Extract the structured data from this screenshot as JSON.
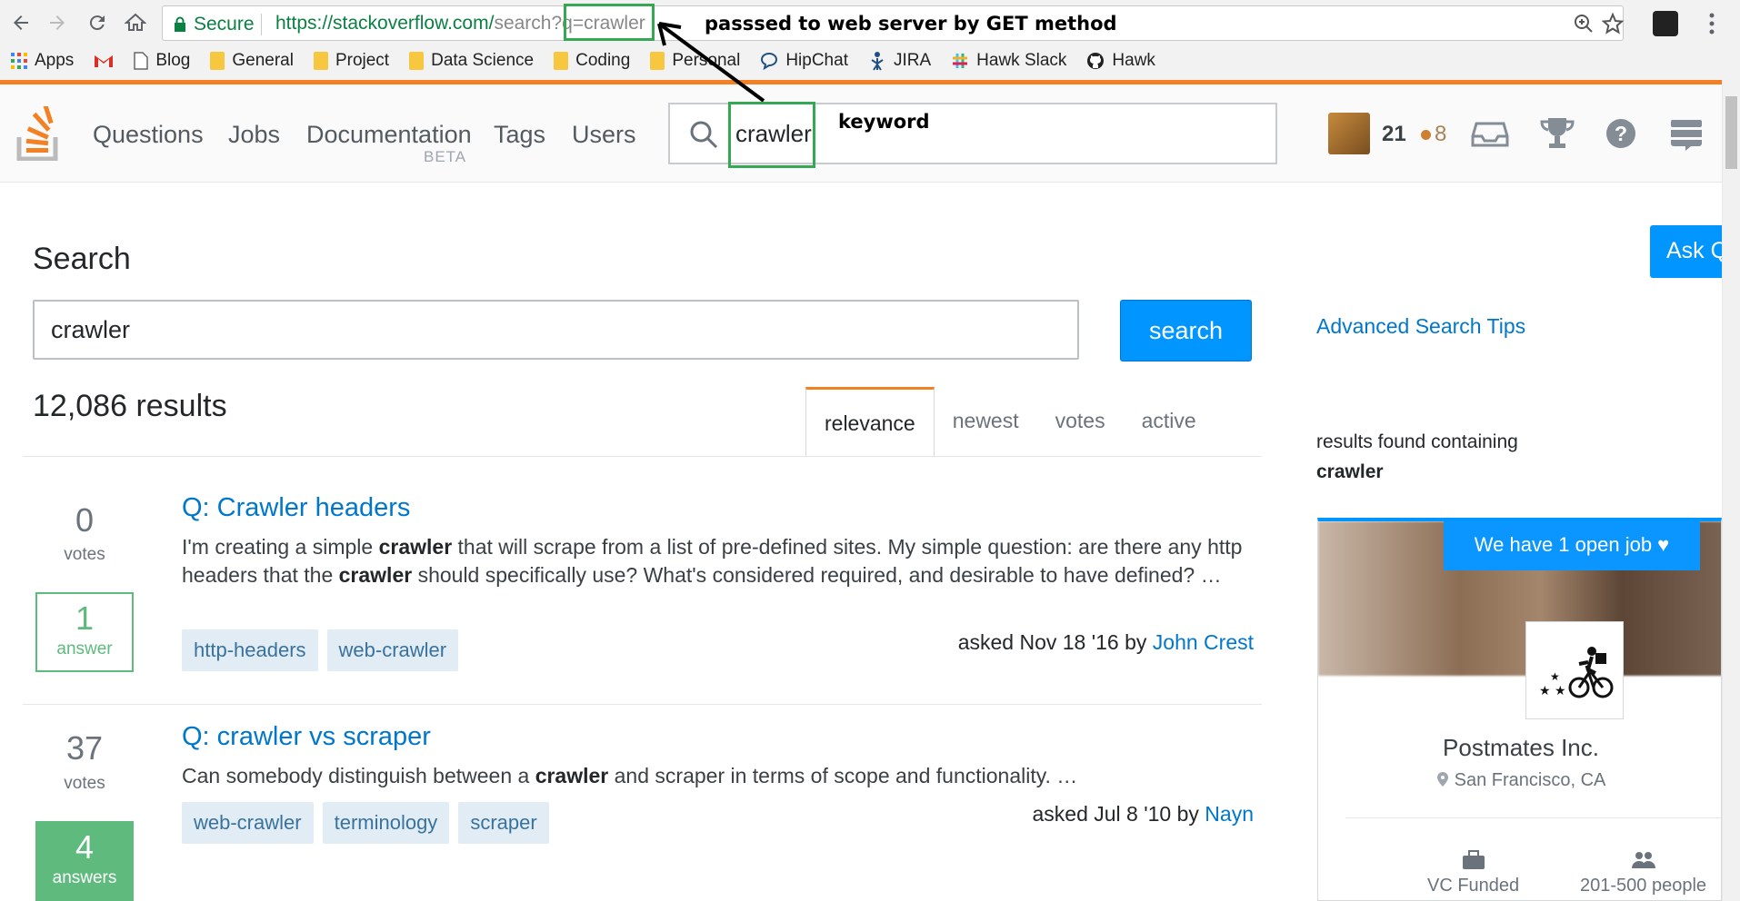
{
  "browser": {
    "secure_label": "Secure",
    "url_host": "https://stackoverflow.com/",
    "url_path": "search?q=crawler",
    "bookmarks": [
      "Apps",
      "Blog",
      "General",
      "Project",
      "Data Science",
      "Coding",
      "Personal",
      "HipChat",
      "JIRA",
      "Hawk Slack",
      "Hawk"
    ]
  },
  "annotations": {
    "arrow_label": "passsed to web server by GET method",
    "keyword_label": "keyword"
  },
  "topbar": {
    "nav": [
      "Questions",
      "Jobs",
      "Documentation",
      "Tags",
      "Users"
    ],
    "beta": "BETA",
    "search_value": "crawler",
    "reputation": "21",
    "bronze_badges": "8"
  },
  "main": {
    "title": "Search",
    "ask_button": "Ask Question",
    "search_value": "crawler",
    "search_button": "search",
    "advanced_tips": "Advanced Search Tips",
    "results_count": "12,086 results",
    "tabs": [
      "relevance",
      "newest",
      "votes",
      "active"
    ]
  },
  "questions": [
    {
      "votes": "0",
      "votes_label": "votes",
      "answers": "1",
      "answers_label": "answer",
      "accepted": false,
      "title": "Q: Crawler headers",
      "excerpt_parts": [
        "I'm creating a simple ",
        "crawler",
        " that will scrape from a list of pre-defined sites. My simple question: are there any http headers that the ",
        "crawler",
        " should specifically use? What's considered required, and desirable to have defined? …"
      ],
      "tags": [
        "http-headers",
        "web-crawler"
      ],
      "asked": "asked Nov 18 '16 by",
      "user": "John Crest"
    },
    {
      "votes": "37",
      "votes_label": "votes",
      "answers": "4",
      "answers_label": "answers",
      "accepted": true,
      "title": "Q: crawler vs scraper",
      "excerpt_parts": [
        "Can somebody distinguish between a ",
        "crawler",
        " and scraper in terms of scope and functionality. …"
      ],
      "tags": [
        "web-crawler",
        "terminology",
        "scraper"
      ],
      "asked": "asked Jul 8 '10 by",
      "user": "Nayn"
    }
  ],
  "sidebar": {
    "found_label": "results found containing",
    "found_term": "crawler",
    "job_pill": "We have 1 open job ♥",
    "company": "Postmates Inc.",
    "location": "San Francisco, CA",
    "perks": [
      "VC Funded",
      "201-500 people"
    ]
  },
  "colors": {
    "so_orange": "#f48024",
    "link_blue": "#0077cc",
    "button_blue": "#0095ff",
    "answered_green": "#5eba7d",
    "annotation_green": "#34a853"
  }
}
